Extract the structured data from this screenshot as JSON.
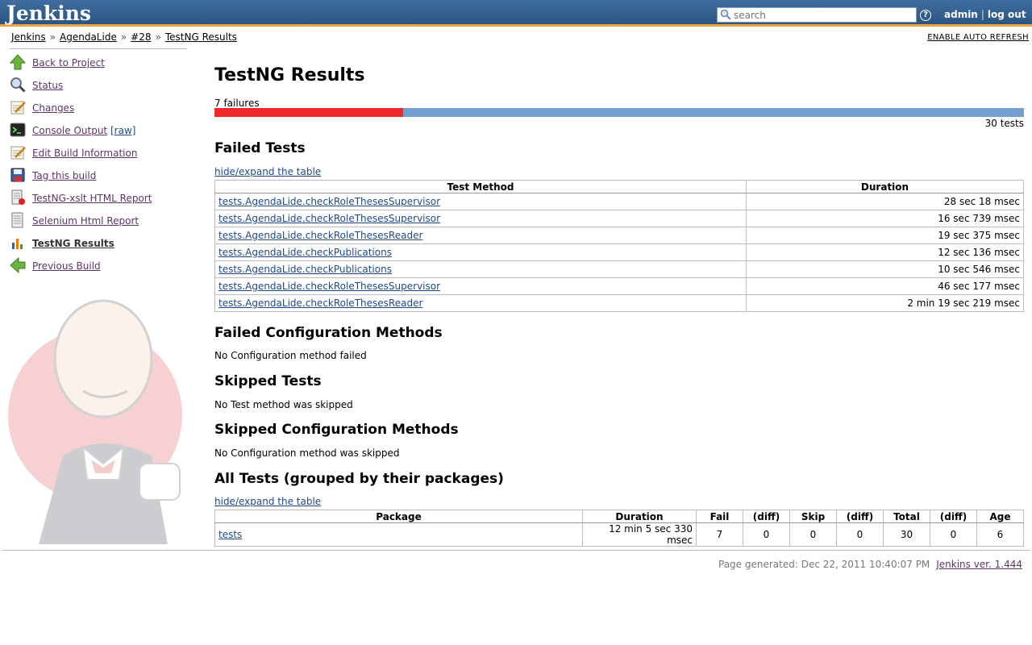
{
  "header": {
    "logo": "Jenkins",
    "search_placeholder": "search",
    "help": "?",
    "user": "admin",
    "separator": "|",
    "logout": "log out"
  },
  "breadcrumb": {
    "items": [
      "Jenkins",
      "AgendaLide",
      "#28",
      "TestNG Results"
    ],
    "sep": "»",
    "auto_refresh": "ENABLE AUTO REFRESH"
  },
  "sidebar": {
    "items": [
      {
        "label": "Back to Project",
        "icon": "up-arrow-icon"
      },
      {
        "label": "Status",
        "icon": "search-icon"
      },
      {
        "label": "Changes",
        "icon": "notepad-icon"
      },
      {
        "label": "Console Output",
        "extra": "[raw]",
        "icon": "terminal-icon"
      },
      {
        "label": "Edit Build Information",
        "icon": "notepad-icon"
      },
      {
        "label": "Tag this build",
        "icon": "floppy-icon"
      },
      {
        "label": "TestNG-xslt HTML Report",
        "icon": "report-icon"
      },
      {
        "label": "Selenium Html Report",
        "icon": "report-icon"
      },
      {
        "label": "TestNG Results",
        "icon": "chart-icon"
      },
      {
        "label": "Previous Build",
        "icon": "left-arrow-icon"
      }
    ]
  },
  "main": {
    "title": "TestNG Results",
    "failures_label": "7 failures",
    "failed_count": 7,
    "total_count": 30,
    "total_label": "30 tests",
    "failed_tests_heading": "Failed Tests",
    "toggle_label": "hide/expand the table",
    "failed_table": {
      "headers": [
        "Test Method",
        "Duration"
      ],
      "rows": [
        [
          "tests.AgendaLide.checkRoleThesesSupervisor",
          "28 sec 18 msec"
        ],
        [
          "tests.AgendaLide.checkRoleThesesSupervisor",
          "16 sec 739 msec"
        ],
        [
          "tests.AgendaLide.checkRoleThesesReader",
          "19 sec 375 msec"
        ],
        [
          "tests.AgendaLide.checkPublications",
          "12 sec 136 msec"
        ],
        [
          "tests.AgendaLide.checkPublications",
          "10 sec 546 msec"
        ],
        [
          "tests.AgendaLide.checkRoleThesesSupervisor",
          "46 sec 177 msec"
        ],
        [
          "tests.AgendaLide.checkRoleThesesReader",
          "2 min 19 sec 219 msec"
        ]
      ]
    },
    "failed_config_heading": "Failed Configuration Methods",
    "failed_config_text": "No Configuration method failed",
    "skipped_tests_heading": "Skipped Tests",
    "skipped_tests_text": "No Test method was skipped",
    "skipped_config_heading": "Skipped Configuration Methods",
    "skipped_config_text": "No Configuration method was skipped",
    "all_tests_heading": "All Tests (grouped by their packages)",
    "packages_table": {
      "headers": [
        "Package",
        "Duration",
        "Fail",
        "(diff)",
        "Skip",
        "(diff)",
        "Total",
        "(diff)",
        "Age"
      ],
      "rows": [
        [
          "tests",
          "12 min 5 sec 330 msec",
          "7",
          "0",
          "0",
          "0",
          "30",
          "0",
          "6"
        ]
      ]
    }
  },
  "footer": {
    "page_generated": "Page generated: Dec 22, 2011 10:40:07 PM",
    "version": "Jenkins ver. 1.444"
  },
  "colors": {
    "header": "#2c5482",
    "header_border": "#f0a24a",
    "fail": "#ef2929",
    "pass": "#729fcf"
  }
}
